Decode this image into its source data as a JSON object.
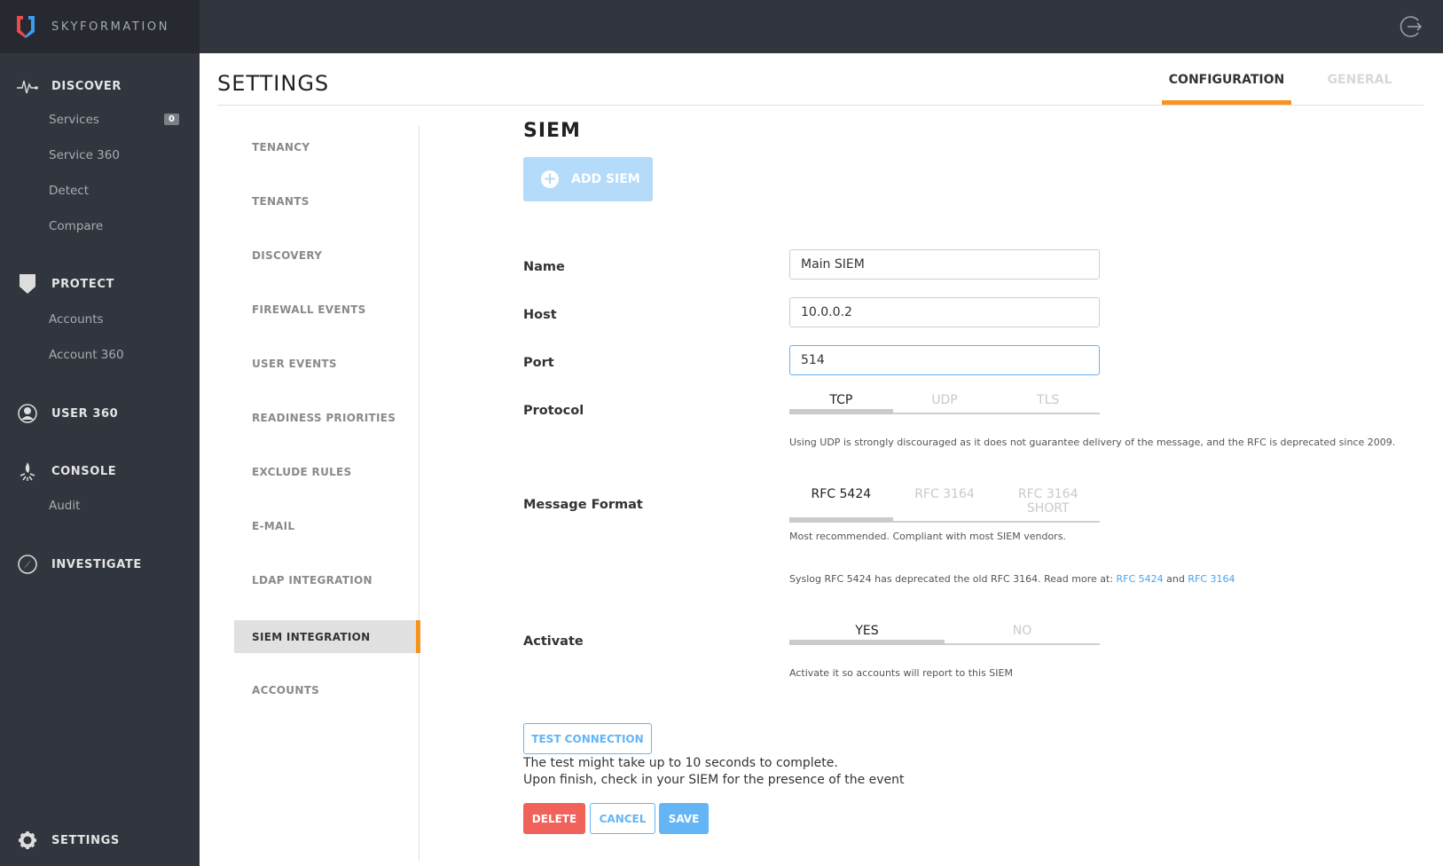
{
  "brand": {
    "name": "SKYFORMATION"
  },
  "sidebar": {
    "sections": [
      {
        "label": "DISCOVER",
        "icon": "pulse-icon",
        "items": [
          {
            "label": "Services",
            "badge": "0"
          },
          {
            "label": "Service 360"
          },
          {
            "label": "Detect"
          },
          {
            "label": "Compare"
          }
        ]
      },
      {
        "label": "PROTECT",
        "icon": "shield-icon",
        "items": [
          {
            "label": "Accounts"
          },
          {
            "label": "Account 360"
          }
        ]
      },
      {
        "label": "USER 360",
        "icon": "user-icon",
        "items": []
      },
      {
        "label": "CONSOLE",
        "icon": "campfire-icon",
        "items": [
          {
            "label": "Audit"
          }
        ]
      },
      {
        "label": "INVESTIGATE",
        "icon": "compass-icon",
        "items": []
      },
      {
        "label": "SETTINGS",
        "icon": "gear-icon",
        "items": []
      }
    ]
  },
  "header": {
    "title": "SETTINGS",
    "tabs": [
      {
        "label": "CONFIGURATION",
        "active": true
      },
      {
        "label": "GENERAL",
        "active": false
      }
    ]
  },
  "subnav": {
    "items": [
      {
        "label": "TENANCY"
      },
      {
        "label": "TENANTS"
      },
      {
        "label": "DISCOVERY"
      },
      {
        "label": "FIREWALL EVENTS"
      },
      {
        "label": "USER EVENTS"
      },
      {
        "label": "READINESS PRIORITIES"
      },
      {
        "label": "EXCLUDE RULES"
      },
      {
        "label": "E-MAIL"
      },
      {
        "label": "LDAP INTEGRATION"
      },
      {
        "label": "SIEM INTEGRATION",
        "active": true
      },
      {
        "label": "ACCOUNTS"
      }
    ]
  },
  "siem": {
    "title": "SIEM",
    "add_button": "ADD SIEM",
    "fields": {
      "name": {
        "label": "Name",
        "value": "Main SIEM"
      },
      "host": {
        "label": "Host",
        "value": "10.0.0.2"
      },
      "port": {
        "label": "Port",
        "value": "514"
      }
    },
    "protocol": {
      "label": "Protocol",
      "options": [
        "TCP",
        "UDP",
        "TLS"
      ],
      "selected": "TCP",
      "hint": "Using UDP is strongly discouraged as it does not guarantee delivery of the message, and the RFC is deprecated since 2009."
    },
    "message_format": {
      "label": "Message Format",
      "options": [
        "RFC 5424",
        "RFC 3164",
        "RFC 3164 SHORT"
      ],
      "selected": "RFC 5424",
      "hint": "Most recommended. Compliant with most SIEM vendors.",
      "note_prefix": "Syslog RFC 5424 has deprecated the old RFC 3164. Read more at: ",
      "link1": "RFC 5424",
      "note_and": " and ",
      "link2": "RFC 3164"
    },
    "activate": {
      "label": "Activate",
      "options": [
        "YES",
        "NO"
      ],
      "selected": "YES",
      "hint": "Activate it so accounts will report to this SIEM"
    },
    "test_button": "TEST CONNECTION",
    "test_note_1": "The test might take up to 10 seconds to complete.",
    "test_note_2": "Upon finish, check in your SIEM for the presence of the event",
    "actions": {
      "delete": "DELETE",
      "cancel": "CANCEL",
      "save": "SAVE"
    }
  },
  "colors": {
    "accent_orange": "#f7931e",
    "primary_blue": "#64b5f6",
    "danger_red": "#f0625a",
    "sidebar_bg": "#31353e"
  }
}
